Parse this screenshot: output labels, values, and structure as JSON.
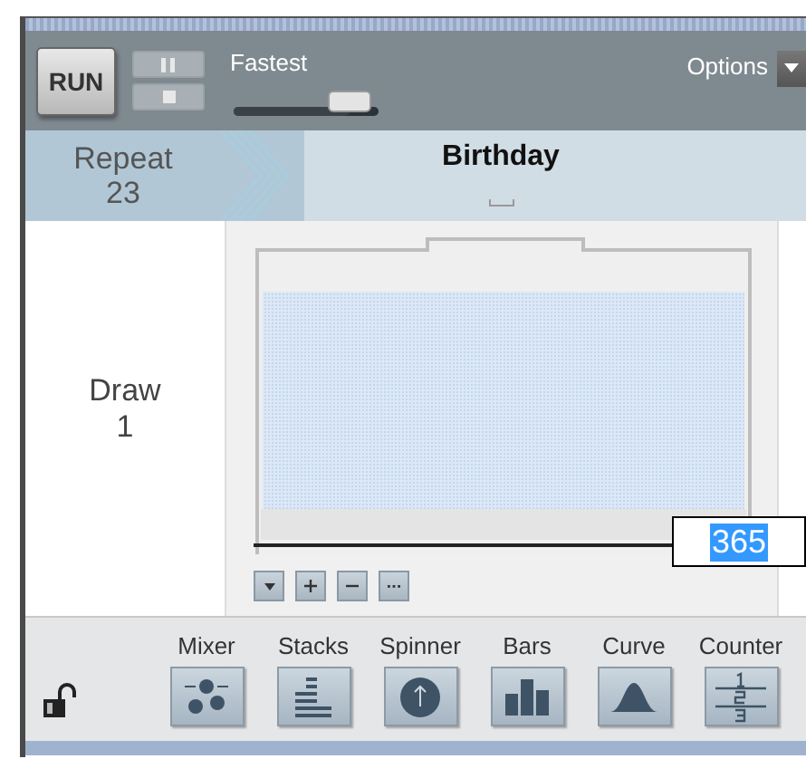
{
  "toolbar": {
    "run_button": "RUN",
    "speed": {
      "label": "Fastest",
      "level": 0.8
    },
    "options": "Options"
  },
  "header": {
    "repeat_label": "Repeat",
    "repeat_count": "23",
    "title": "Birthday"
  },
  "draw": {
    "label": "Draw",
    "count": "1"
  },
  "device": {
    "value": "365"
  },
  "palette": {
    "locked": false,
    "items": [
      {
        "label": "Mixer",
        "kind": "mixer"
      },
      {
        "label": "Stacks",
        "kind": "stacks"
      },
      {
        "label": "Spinner",
        "kind": "spinner"
      },
      {
        "label": "Bars",
        "kind": "bars"
      },
      {
        "label": "Curve",
        "kind": "curve"
      },
      {
        "label": "Counter",
        "kind": "counter"
      }
    ]
  }
}
